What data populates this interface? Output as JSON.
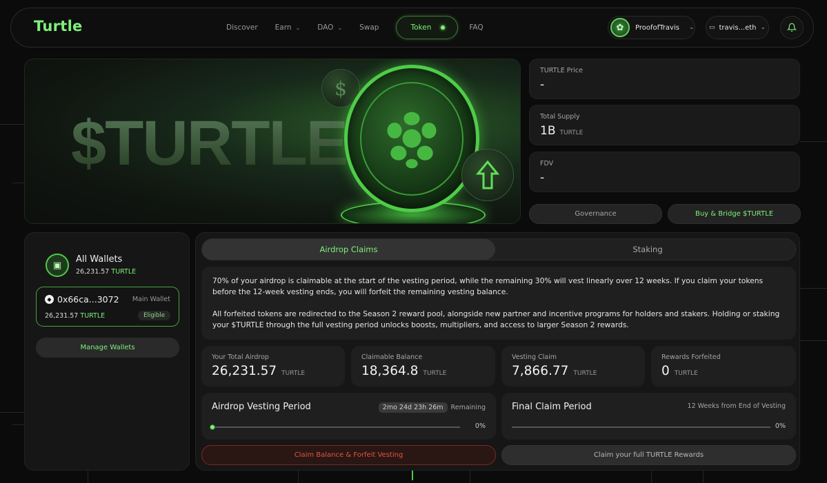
{
  "brand": {
    "logo": "Turtle",
    "accent": "#7ff07a"
  },
  "nav": {
    "links": [
      {
        "label": "Discover"
      },
      {
        "label": "Earn"
      },
      {
        "label": "DAO"
      },
      {
        "label": "Swap"
      },
      {
        "label": "Token"
      },
      {
        "label": "FAQ"
      }
    ],
    "user": "ProofofTravis",
    "wallet": "travis...eth"
  },
  "hero": {
    "title": "$TURTLE",
    "coin_symbol": "$"
  },
  "stats": {
    "price": {
      "label": "TURTLE Price",
      "value": "-"
    },
    "supply": {
      "label": "Total Supply",
      "value": "1B",
      "unit": "TURTLE"
    },
    "fdv": {
      "label": "FDV",
      "value": "-"
    }
  },
  "actions": {
    "governance": "Governance",
    "buy_bridge": "Buy & Bridge $TURTLE"
  },
  "wallets": {
    "title": "All Wallets",
    "amount": "26,231.57",
    "unit": "TURTLE",
    "items": [
      {
        "address": "0x66ca...3072",
        "tag": "Main Wallet",
        "amount": "26,231.57",
        "unit": "TURTLE",
        "badge": "Eligible"
      }
    ],
    "manage_label": "Manage Wallets"
  },
  "tabs": {
    "active": "Airdrop Claims",
    "inactive": "Staking"
  },
  "info": {
    "p1": "70% of your airdrop is claimable at the start of the vesting period, while the remaining 30% will vest linearly over 12 weeks. If you claim your tokens before the 12-week vesting ends, you will forfeit the remaining vesting balance.",
    "p2": "All forfeited tokens are redirected to the Season 2 reward pool, alongside new partner and incentive programs for holders and stakers. Holding or staking your $TURTLE through the full vesting period unlocks boosts, multipliers, and access to larger Season 2 rewards."
  },
  "metrics": [
    {
      "label": "Your Total Airdrop",
      "value": "26,231.57",
      "unit": "TURTLE"
    },
    {
      "label": "Claimable Balance",
      "value": "18,364.8",
      "unit": "TURTLE"
    },
    {
      "label": "Vesting Claim",
      "value": "7,866.77",
      "unit": "TURTLE"
    },
    {
      "label": "Rewards Forfeited",
      "value": "0",
      "unit": "TURTLE"
    }
  ],
  "vesting": {
    "title": "Airdrop Vesting Period",
    "countdown": "2mo 24d 23h 26m",
    "remaining_label": "Remaining",
    "progress": "0%"
  },
  "final_claim": {
    "title": "Final Claim Period",
    "note": "12 Weeks from End of Vesting",
    "progress": "0%"
  },
  "buttons": {
    "forfeit": "Claim Balance & Forfeit Vesting",
    "claim_full": "Claim your full TURTLE Rewards"
  }
}
